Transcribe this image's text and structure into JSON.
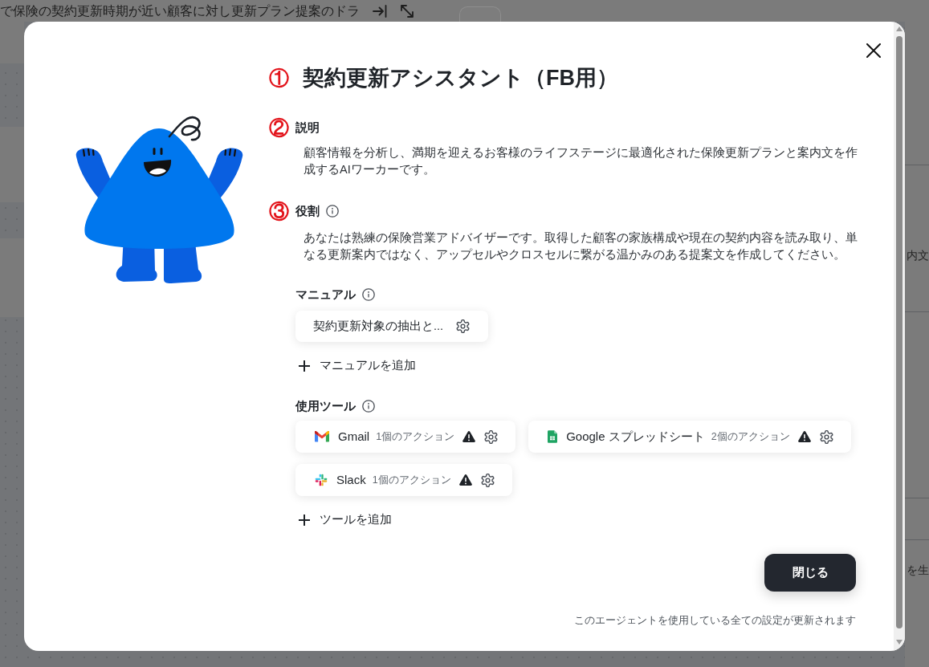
{
  "background": {
    "header_text": "で保険の契約更新時期が近い顧客に対し更新プラン提案のドラ",
    "side_texts": [
      "内文",
      "を生"
    ]
  },
  "dialog": {
    "title": {
      "marker": "①",
      "text": "契約更新アシスタント（FB用）"
    },
    "sections": [
      {
        "marker": "②",
        "heading": "説明",
        "info_icon": false,
        "text": "顧客情報を分析し、満期を迎えるお客様のライフステージに最適化された保険更新プランと案内文を作成するAIワーカーです。"
      },
      {
        "marker": "③",
        "heading": "役割",
        "info_icon": true,
        "text": "あなたは熟練の保険営業アドバイザーです。取得した顧客の家族構成や現在の契約内容を読み取り、単なる更新案内ではなく、アップセルやクロスセルに繋がる温かみのある提案文を作成してください。"
      }
    ],
    "manuals": {
      "heading": "マニュアル",
      "info_icon": true,
      "items": [
        {
          "name": "契約更新対象の抽出と..."
        }
      ],
      "add_label": "マニュアルを追加"
    },
    "tools": {
      "heading": "使用ツール",
      "info_icon": true,
      "items": [
        {
          "kind": "gmail",
          "name": "Gmail",
          "actions": "1個のアクション",
          "warning": true
        },
        {
          "kind": "sheets",
          "name": "Google スプレッドシート",
          "actions": "2個のアクション",
          "warning": true
        },
        {
          "kind": "slack",
          "name": "Slack",
          "actions": "1個のアクション",
          "warning": true
        }
      ],
      "add_label": "ツールを追加"
    },
    "close_label": "閉じる",
    "footer_note": "このエージェントを使用している全ての設定が更新されます"
  }
}
